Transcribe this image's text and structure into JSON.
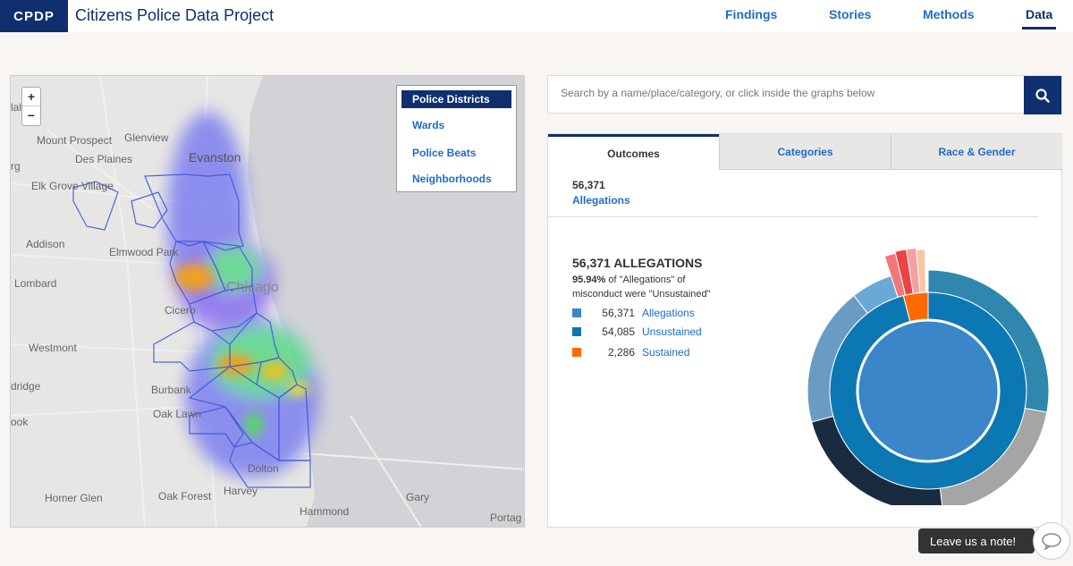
{
  "header": {
    "logo": "CPDP",
    "title": "Citizens Police Data Project",
    "nav": [
      "Findings",
      "Stories",
      "Methods",
      "Data"
    ],
    "active_nav": "Data"
  },
  "map": {
    "zoom_in": "+",
    "zoom_out": "−",
    "layers": [
      "Police Districts",
      "Wards",
      "Police Beats",
      "Neighborhoods"
    ],
    "active_layer": "Police Districts",
    "place_labels": [
      "Mount Prospect",
      "Glenview",
      "Des Plaines",
      "Evanston",
      "Elk Grove Village",
      "Addison",
      "Elmwood Park",
      "Lombard",
      "Chicago",
      "Cicero",
      "Westmont",
      "Burbank",
      "Oak Lawn",
      "Dolton",
      "Homer Glen",
      "Oak Forest",
      "Harvey",
      "Gary",
      "Hammond",
      "Portag",
      "rg",
      "lal",
      "dridge",
      "ook"
    ]
  },
  "search": {
    "placeholder": "Search by a name/place/category, or click inside the graphs below"
  },
  "tabs": [
    "Outcomes",
    "Categories",
    "Race & Gender"
  ],
  "active_tab": "Outcomes",
  "summary": {
    "count": "56,371",
    "label": "Allegations"
  },
  "detail": {
    "title": "56,371 ALLEGATIONS",
    "pct": "95.94%",
    "pct_text_1": " of \"Allegations\" of",
    "pct_text_2": "misconduct were \"Unsustained\"",
    "legend": [
      {
        "value": "56,371",
        "name": "Allegations",
        "color": "#3a86c8"
      },
      {
        "value": "54,085",
        "name": "Unsustained",
        "color": "#0b78b4"
      },
      {
        "value": "2,286",
        "name": "Sustained",
        "color": "#ff6a00"
      }
    ]
  },
  "chart_data": {
    "type": "pie",
    "rings": [
      {
        "name": "Allegations",
        "values": [
          56371
        ]
      },
      {
        "name": "Outcome",
        "labels": [
          "Unsustained",
          "Sustained"
        ],
        "values": [
          54085,
          2286
        ]
      }
    ]
  },
  "feedback": {
    "label": "Leave us a note!"
  },
  "colors": {
    "brand": "#0f2f6f",
    "link": "#1e6cc8",
    "unsustained": "#0b78b4",
    "sustained": "#ff6a00",
    "allegations": "#3a86c8"
  }
}
